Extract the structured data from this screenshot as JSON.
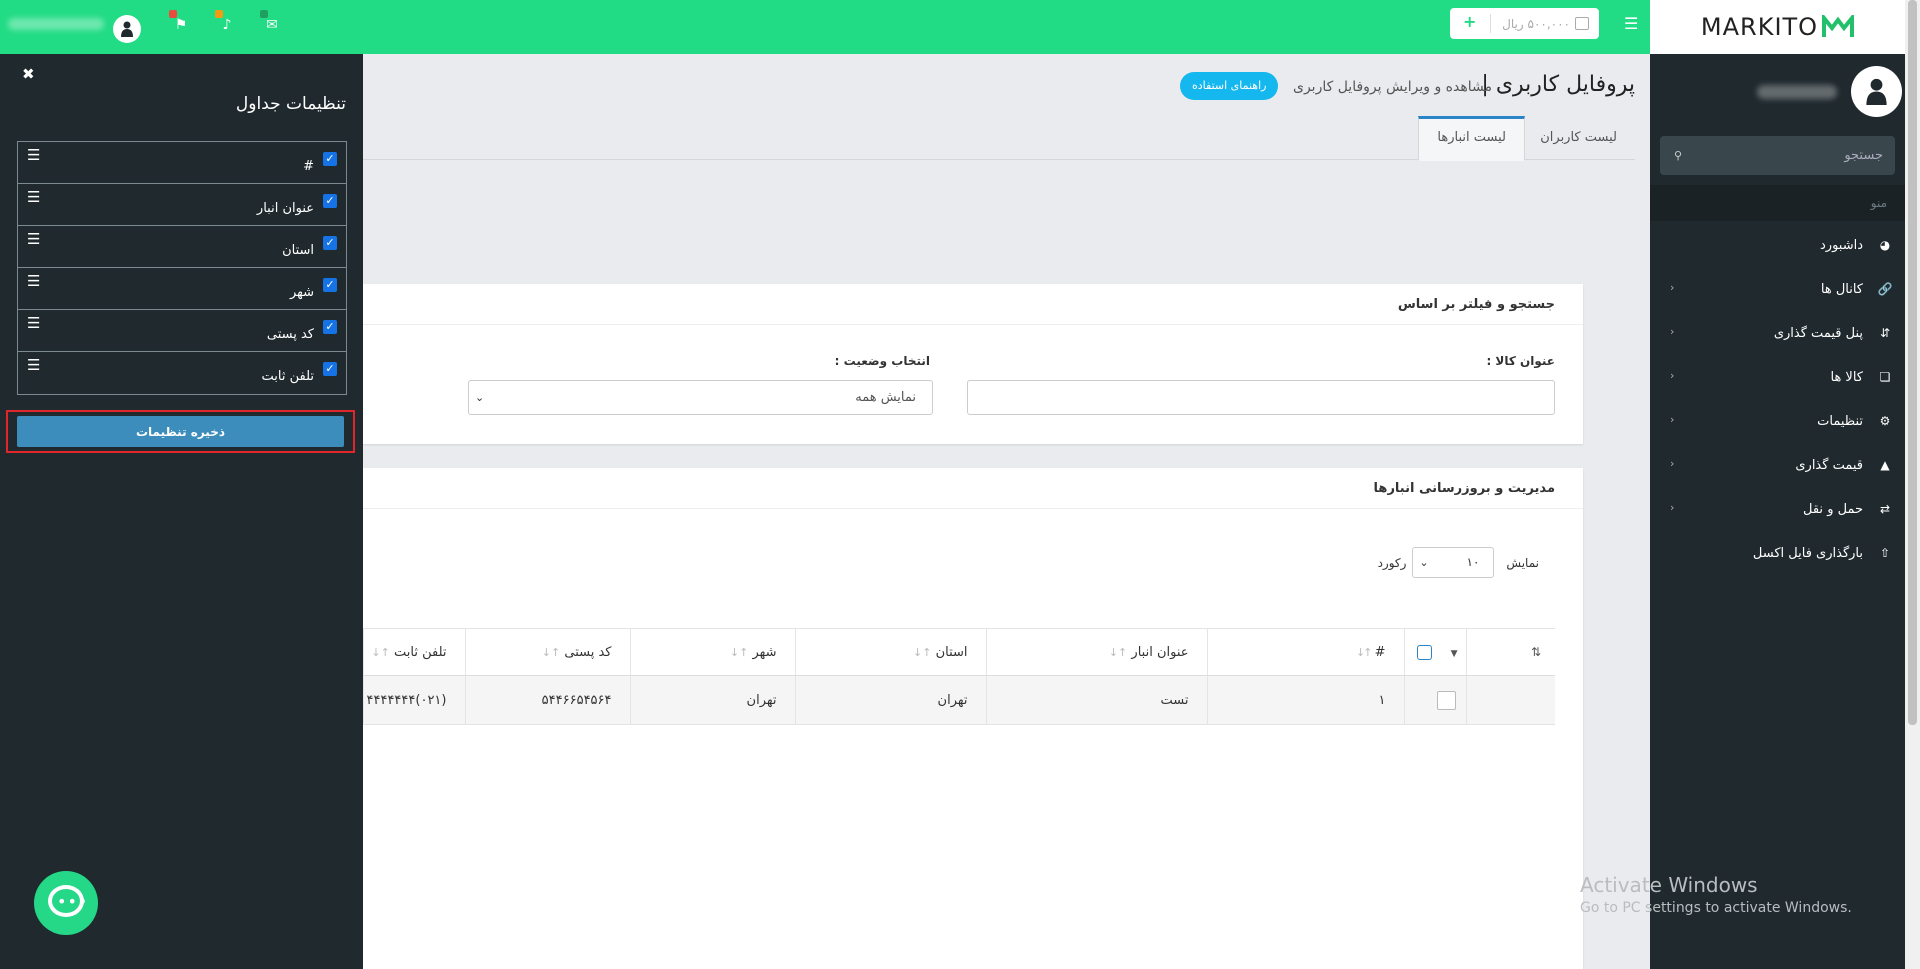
{
  "topbar": {
    "wallet_amount": "۵۰۰,۰۰۰ ریال",
    "user_name_blurred": "نام کاربر"
  },
  "sidebar": {
    "logo": "MARKITO",
    "profile_name_blurred": "نام کاربر",
    "search_placeholder": "جستجو",
    "menu_header": "منو",
    "items": [
      {
        "label": "داشبورد",
        "icon": "dashboard-icon",
        "has_submenu": false
      },
      {
        "label": "کانال ها",
        "icon": "link-icon",
        "has_submenu": true
      },
      {
        "label": "پنل قیمت گذاری",
        "icon": "sort-icon",
        "has_submenu": true
      },
      {
        "label": "کالا ها",
        "icon": "cubes-icon",
        "has_submenu": true
      },
      {
        "label": "تنظیمات",
        "icon": "gear-icon",
        "has_submenu": true
      },
      {
        "label": "قیمت گذاری",
        "icon": "area-chart-icon",
        "has_submenu": true
      },
      {
        "label": "حمل و نقل",
        "icon": "exchange-icon",
        "has_submenu": true
      },
      {
        "label": "بارگذاری فایل اکسل",
        "icon": "upload-icon",
        "has_submenu": false
      }
    ]
  },
  "header": {
    "title": "پروفایل کاربری |",
    "subtitle": "مشاهده و ویرایش پروفایل کاربری",
    "guide_button": "راهنمای استفاده"
  },
  "tabs": [
    {
      "label": "لیست کاربران",
      "active": false
    },
    {
      "label": "لیست انبارها",
      "active": true
    }
  ],
  "filter_card": {
    "title": "جستجو و فیلتر بر اساس",
    "product_label": "عنوان کالا :",
    "product_value": "",
    "status_label": "انتخاب وضعیت :",
    "status_value": "نمایش همه"
  },
  "table_card": {
    "title": "مدیریت و بروزرسانی انبارها",
    "show_label": "نمایش",
    "page_size": "۱۰",
    "records_label": "رکورد",
    "columns": [
      "#",
      "عنوان انبار",
      "استان",
      "شهر",
      "کد پستی",
      "تلفن ثابت"
    ],
    "rows": [
      {
        "num": "۱",
        "title": "تست",
        "province": "تهران",
        "city": "تهران",
        "postal": "۵۴۴۶۶۵۴۵۶۴",
        "phone": "(۰۲۱)۴۴۴۴۴۴۴"
      }
    ]
  },
  "settings_panel": {
    "title": "تنظیمات جداول",
    "columns": [
      {
        "label": "#",
        "checked": true
      },
      {
        "label": "عنوان انبار",
        "checked": true
      },
      {
        "label": "استان",
        "checked": true
      },
      {
        "label": "شهر",
        "checked": true
      },
      {
        "label": "کد پستی",
        "checked": true
      },
      {
        "label": "تلفن ثابت",
        "checked": true
      }
    ],
    "save_button": "ذخیره تنظیمات"
  },
  "watermark": {
    "line1": "Activate Windows",
    "line2": "Go to PC settings to activate Windows."
  },
  "colors": {
    "topbar": "#22dc85",
    "sidebar": "#202a2e",
    "primary_button": "#3c8dbc",
    "guide_button": "#15b7ef",
    "highlight_border": "#e0262b"
  }
}
